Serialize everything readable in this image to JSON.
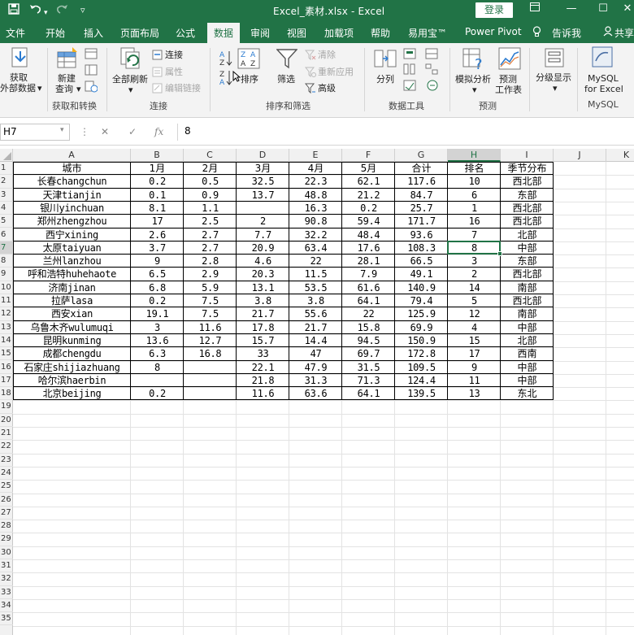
{
  "titlebar": {
    "title": "Excel_素材.xlsx  -  Excel",
    "login": "登录",
    "save_icon": "save-icon",
    "undo_icon": "undo-icon",
    "redo_icon": "redo-icon",
    "customize_icon": "customize-quick-access-icon"
  },
  "tabs": [
    "文件",
    "开始",
    "插入",
    "页面布局",
    "公式",
    "数据",
    "审阅",
    "视图",
    "加载项",
    "帮助",
    "易用宝™",
    "Power Pivot",
    "告诉我",
    "共享"
  ],
  "active_tab": "数据",
  "ribbon": {
    "get_data": [
      "获取",
      "外部数据"
    ],
    "new_query": [
      "新建",
      "查询"
    ],
    "refresh_all": "全部刷新",
    "connections": "连接",
    "properties": "属性",
    "edit_links": "编辑链接",
    "sort_asc": "A↓Z",
    "sort": "排序",
    "filter": "筛选",
    "clear": "清除",
    "reapply": "重新应用",
    "advanced": "高级",
    "text_to_columns": "分列",
    "what_if": "模拟分析",
    "forecast_sheet": [
      "预测",
      "工作表"
    ],
    "outline": "分级显示",
    "mysql": [
      "MySQL",
      "for Excel"
    ],
    "groups": [
      "获取和转换",
      "连接",
      "排序和筛选",
      "数据工具",
      "预测",
      "MySQL"
    ]
  },
  "formula_bar": {
    "name_box": "H7",
    "value": "8",
    "cancel": "✕",
    "enter": "✓",
    "fx": "fx"
  },
  "columns": [
    "A",
    "B",
    "C",
    "D",
    "E",
    "F",
    "G",
    "H",
    "I",
    "J",
    "K"
  ],
  "selected_column": "H",
  "selected_row": "7",
  "rows": [
    "1",
    "2",
    "3",
    "4",
    "5",
    "6",
    "7",
    "8",
    "9",
    "10",
    "11",
    "12",
    "13",
    "14",
    "15",
    "16",
    "17",
    "18",
    "19",
    "20",
    "21",
    "22",
    "23",
    "24",
    "25",
    "26",
    "27",
    "28",
    "29",
    "30",
    "31",
    "32",
    "33",
    "34",
    "35"
  ],
  "table": {
    "header": [
      "城市",
      "1月",
      "2月",
      "3月",
      "4月",
      "5月",
      "合计",
      "排名",
      "季节分布"
    ],
    "rows": [
      [
        "长春changchun",
        "0.2",
        "0.5",
        "32.5",
        "22.3",
        "62.1",
        "117.6",
        "10",
        "西北部"
      ],
      [
        "天津tianjin",
        "0.1",
        "0.9",
        "13.7",
        "48.8",
        "21.2",
        "84.7",
        "6",
        "东部"
      ],
      [
        "银川yinchuan",
        "8.1",
        "1.1",
        "",
        "16.3",
        "0.2",
        "25.7",
        "1",
        "西北部"
      ],
      [
        "郑州zhengzhou",
        "17",
        "2.5",
        "2",
        "90.8",
        "59.4",
        "171.7",
        "16",
        "西北部"
      ],
      [
        "西宁xining",
        "2.6",
        "2.7",
        "7.7",
        "32.2",
        "48.4",
        "93.6",
        "7",
        "北部"
      ],
      [
        "太原taiyuan",
        "3.7",
        "2.7",
        "20.9",
        "63.4",
        "17.6",
        "108.3",
        "8",
        "中部"
      ],
      [
        "兰州lanzhou",
        "9",
        "2.8",
        "4.6",
        "22",
        "28.1",
        "66.5",
        "3",
        "东部"
      ],
      [
        "呼和浩特huhehaote",
        "6.5",
        "2.9",
        "20.3",
        "11.5",
        "7.9",
        "49.1",
        "2",
        "西北部"
      ],
      [
        "济南jinan",
        "6.8",
        "5.9",
        "13.1",
        "53.5",
        "61.6",
        "140.9",
        "14",
        "南部"
      ],
      [
        "拉萨lasa",
        "0.2",
        "7.5",
        "3.8",
        "3.8",
        "64.1",
        "79.4",
        "5",
        "西北部"
      ],
      [
        "西安xian",
        "19.1",
        "7.5",
        "21.7",
        "55.6",
        "22",
        "125.9",
        "12",
        "南部"
      ],
      [
        "乌鲁木齐wulumuqi",
        "3",
        "11.6",
        "17.8",
        "21.7",
        "15.8",
        "69.9",
        "4",
        "中部"
      ],
      [
        "昆明kunming",
        "13.6",
        "12.7",
        "15.7",
        "14.4",
        "94.5",
        "150.9",
        "15",
        "北部"
      ],
      [
        "成都chengdu",
        "6.3",
        "16.8",
        "33",
        "47",
        "69.7",
        "172.8",
        "17",
        "西南"
      ],
      [
        "石家庄shijiazhuang",
        "8",
        "",
        "22.1",
        "47.9",
        "31.5",
        "109.5",
        "9",
        "中部"
      ],
      [
        "哈尔滨haerbin",
        "",
        "",
        "21.8",
        "31.3",
        "71.3",
        "124.4",
        "11",
        "中部"
      ],
      [
        "北京beijing",
        "0.2",
        "",
        "11.6",
        "63.6",
        "64.1",
        "139.5",
        "13",
        "东北"
      ]
    ]
  }
}
